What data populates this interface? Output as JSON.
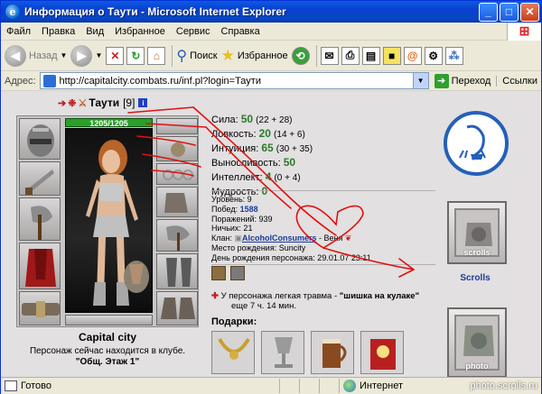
{
  "window": {
    "title": "Информация о Таути - Microsoft Internet Explorer",
    "ie_glyph": "e",
    "minimize": "_",
    "maximize": "□",
    "close": "✕"
  },
  "menu": [
    "Файл",
    "Правка",
    "Вид",
    "Избранное",
    "Сервис",
    "Справка"
  ],
  "toolbar": {
    "back": "Назад",
    "forward_icon": "forward-arrow-icon",
    "search": "Поиск",
    "favorites": "Избранное"
  },
  "address": {
    "label": "Адрес:",
    "url": "http://capitalcity.combats.ru/inf.pl?login=Таути",
    "go": "Переход",
    "links": "Ссылки"
  },
  "character": {
    "name": "Таути",
    "level": "[9]",
    "info_badge": "i",
    "hp": "1205/1205",
    "stats": [
      {
        "label": "Сила:",
        "value": "50",
        "extra": "(22 + 28)"
      },
      {
        "label": "Ловкость:",
        "value": "20",
        "extra": "(14 + 6)"
      },
      {
        "label": "Интуиция:",
        "value": "65",
        "extra": "(30 + 35)"
      },
      {
        "label": "Выносливость:",
        "value": "50",
        "extra": ""
      },
      {
        "label": "Интеллект:",
        "value": "4",
        "extra": "(0 + 4)"
      },
      {
        "label": "Мудрость:",
        "value": "0",
        "extra": ""
      }
    ],
    "details": {
      "level": "Уровень: 9",
      "wins_label": "Побед:",
      "wins": "1588",
      "losses": "Поражений: 939",
      "draws": "Ничьих: 21",
      "clan_label": "Клан:",
      "clan": "AlcoholConsumers",
      "clan_rank": "- Веня",
      "birthplace": "Место рождения: Suncity",
      "birthday": "День рождения персонажа: 29.01.07 23:11"
    },
    "trauma_pre": "У персонажа легкая травма - ",
    "trauma_name": "\"шишка на кулаке\"",
    "trauma_post": "еще 7 ч. 14 мин.",
    "gifts_label": "Подарки:",
    "city": "Capital city",
    "status": "Персонаж сейчас находится в клубе.",
    "room": "\"Общ. Этаж 1\""
  },
  "sidebar": {
    "scrolls_label": "Scrolls",
    "scroll_watermark": "scrolls",
    "photo_watermark": "photo"
  },
  "status": {
    "ready": "Готово",
    "zone": "Интернет"
  },
  "watermark": "photo.scrolls.ru",
  "colors": {
    "accent": "#0a3fd0",
    "stat_value": "#2a7a2a",
    "link": "#1a3a9a",
    "hp": "#2aa02a",
    "annotation": "#e01010"
  }
}
